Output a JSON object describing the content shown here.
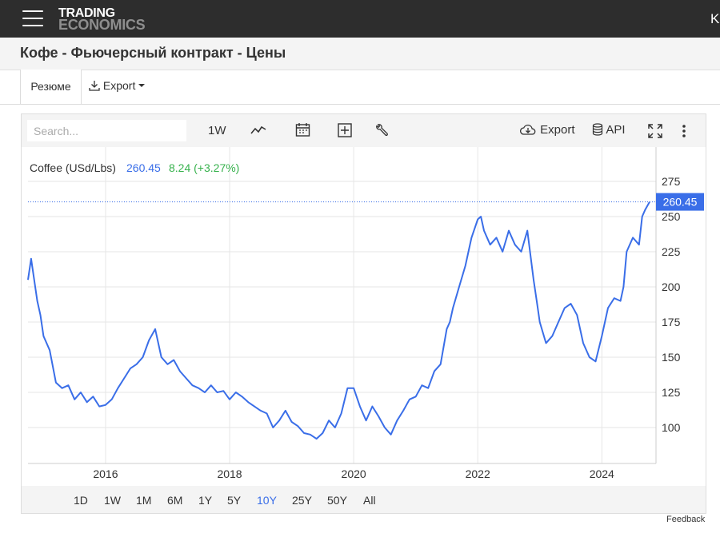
{
  "header": {
    "logo_line1": "TRADING",
    "logo_line2": "ECONOMICS",
    "right_fragment": "K"
  },
  "page": {
    "title": "Кофе - Фьючерсный контракт - Цены"
  },
  "tabs": {
    "summary": "Резюме",
    "export": "Export"
  },
  "toolbar": {
    "search_placeholder": "Search...",
    "period": "1W",
    "export": "Export",
    "api": "API"
  },
  "legend": {
    "name": "Coffee (USd/Lbs)",
    "last": "260.45",
    "change": "8.24 (+3.27%)"
  },
  "ranges": [
    "1D",
    "1W",
    "1M",
    "6M",
    "1Y",
    "5Y",
    "10Y",
    "25Y",
    "50Y",
    "All"
  ],
  "active_range": "10Y",
  "feedback": "Feedback",
  "colors": {
    "line": "#3a6ee8",
    "change": "#37b24d",
    "topbar": "#2d2d2d"
  },
  "chart_data": {
    "type": "line",
    "xlabel": "",
    "ylabel": "",
    "ylim": [
      80,
      285
    ],
    "xlim": [
      2014.75,
      2024.77
    ],
    "y_ticks": [
      100,
      125,
      150,
      175,
      200,
      225,
      250,
      275
    ],
    "x_ticks": [
      "2016",
      "2018",
      "2020",
      "2022",
      "2024"
    ],
    "x_tick_values": [
      2016,
      2018,
      2020,
      2022,
      2024
    ],
    "last_value": 260.45,
    "grid": true,
    "series": [
      {
        "name": "Coffee (USd/Lbs)",
        "x": [
          2014.75,
          2014.8,
          2014.9,
          2014.95,
          2015.0,
          2015.1,
          2015.2,
          2015.3,
          2015.4,
          2015.5,
          2015.6,
          2015.7,
          2015.8,
          2015.9,
          2016.0,
          2016.1,
          2016.2,
          2016.3,
          2016.4,
          2016.5,
          2016.6,
          2016.7,
          2016.8,
          2016.9,
          2017.0,
          2017.1,
          2017.2,
          2017.3,
          2017.4,
          2017.5,
          2017.6,
          2017.7,
          2017.8,
          2017.9,
          2018.0,
          2018.1,
          2018.2,
          2018.3,
          2018.4,
          2018.5,
          2018.6,
          2018.7,
          2018.8,
          2018.9,
          2019.0,
          2019.1,
          2019.2,
          2019.3,
          2019.4,
          2019.5,
          2019.6,
          2019.7,
          2019.8,
          2019.9,
          2020.0,
          2020.1,
          2020.2,
          2020.3,
          2020.4,
          2020.5,
          2020.6,
          2020.7,
          2020.8,
          2020.9,
          2021.0,
          2021.1,
          2021.2,
          2021.3,
          2021.4,
          2021.5,
          2021.55,
          2021.6,
          2021.7,
          2021.8,
          2021.9,
          2022.0,
          2022.05,
          2022.1,
          2022.2,
          2022.3,
          2022.4,
          2022.5,
          2022.6,
          2022.7,
          2022.8,
          2022.9,
          2022.95,
          2023.0,
          2023.1,
          2023.2,
          2023.3,
          2023.4,
          2023.5,
          2023.6,
          2023.7,
          2023.8,
          2023.9,
          2024.0,
          2024.1,
          2024.2,
          2024.3,
          2024.35,
          2024.4,
          2024.5,
          2024.6,
          2024.65,
          2024.7,
          2024.77
        ],
        "values": [
          205,
          220,
          190,
          180,
          165,
          155,
          132,
          128,
          130,
          120,
          125,
          118,
          122,
          115,
          116,
          120,
          128,
          135,
          142,
          145,
          150,
          162,
          170,
          150,
          145,
          148,
          140,
          135,
          130,
          128,
          125,
          130,
          125,
          126,
          120,
          125,
          122,
          118,
          115,
          112,
          110,
          100,
          105,
          112,
          104,
          101,
          96,
          95,
          92,
          96,
          105,
          100,
          110,
          128,
          128,
          115,
          105,
          115,
          108,
          100,
          95,
          105,
          112,
          120,
          122,
          130,
          128,
          140,
          145,
          170,
          175,
          185,
          200,
          215,
          235,
          248,
          250,
          240,
          230,
          235,
          225,
          240,
          230,
          225,
          240,
          205,
          190,
          175,
          160,
          165,
          175,
          185,
          188,
          180,
          160,
          150,
          147,
          165,
          185,
          192,
          190,
          200,
          225,
          235,
          230,
          250,
          255,
          260.45
        ]
      }
    ]
  }
}
